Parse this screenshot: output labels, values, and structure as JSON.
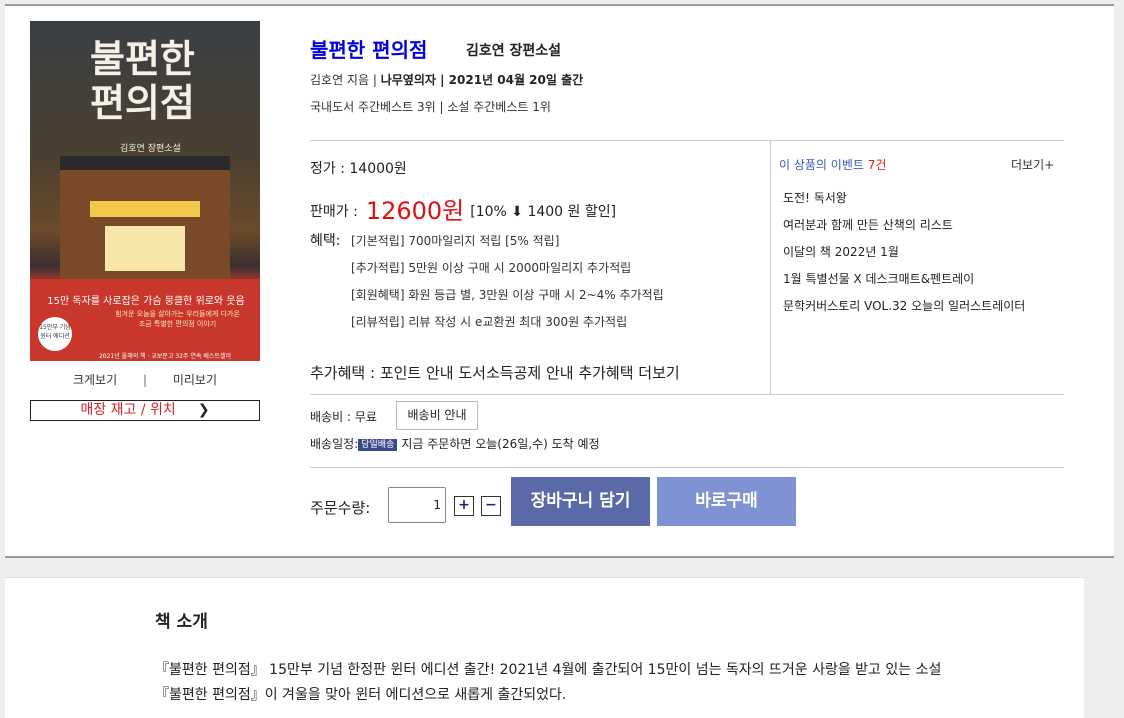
{
  "book": {
    "title": "불편한 편의점",
    "subtitle": "김호연 장편소설",
    "author": "김호연 지음 |",
    "publisher_date": "나무옆의자 | 2021년 04월 20일 출간",
    "ranking": "국내도서 주간베스트 3위 | 소설 주간베스트 1위"
  },
  "cover": {
    "title_line1": "불편한",
    "title_line2": "편의점",
    "author_small": "김호연 장편소설",
    "tagline": "15만 독자를 사로잡은 가슴 뭉클한 위로와 웃음",
    "sub_line1": "힘겨운 오늘을 살아가는 우리들에게 다가온",
    "sub_line2": "조금 특별한 편의점 이야기",
    "badge": "15만부 기념 윈터 에디션",
    "footer": "2021년 올해의 책 · 교보문고 32주 연속 베스트셀러"
  },
  "links": {
    "enlarge": "크게보기",
    "sep": "|",
    "preview": "미리보기",
    "stock": "매장 재고 / 위치"
  },
  "price": {
    "list": "정가 : 14000원",
    "sale_label": "판매가 :",
    "sale_amount": "12600원",
    "discount": "[10% ⬇ 1400 원 할인]",
    "benefit_label": "혜택:",
    "benefits": [
      "[기본적립] 700마일리지 적립 [5% 적립]",
      "[추가적립] 5만원 이상 구매 시 2000마일리지 추가적립",
      "[회원혜택] 화원 등급 별, 3만원 이상 구매 시 2~4% 추가적립",
      "[리뷰적립] 리뷰 작성 시 e교환권 최대 300원 추가적립"
    ],
    "extra_label": "추가혜택 :",
    "extra_items": [
      "포인트 안내",
      "도서소득공제 안내",
      "추가혜택 더보기"
    ]
  },
  "events": {
    "head": "이 상품의 이벤트",
    "count": "7건",
    "more": "더보기+",
    "items": [
      "도전! 독서왕",
      "여러분과 함께 만든 산책의 리스트",
      "이달의 책 2022년 1월",
      "1월 특별선물 X 데스크매트&펜트레이",
      "문학커버스토리 VOL.32 오늘의 일러스트레이터"
    ]
  },
  "shipping": {
    "fee": "배송비 : 무료",
    "fee_button": "배송비 안내",
    "schedule_label": "배송일정:",
    "schedule_tag": "당일배송",
    "schedule_text": "지금 주문하면 오늘(26일,수) 도착 예정"
  },
  "order": {
    "qty_label": "주문수량:",
    "qty_value": "1",
    "plus": "+",
    "minus": "−",
    "cart": "장바구니 담기",
    "buy": "바로구매"
  },
  "intro": {
    "title": "책 소개",
    "text": "『불편한 편의점』 15만부 기념 한정판 윈터 에디션 출간! 2021년 4월에 출간되어 15만이 넘는 독자의 뜨거운 사랑을 받고 있는 소설 『불편한 편의점』이 겨울을 맞아 윈터 에디션으로 새롭게 출간되었다."
  },
  "colors": {
    "title": "#0000dd",
    "sale": "#e01010",
    "cart": "#5a6aa8",
    "buy": "#7f93d4",
    "event_head": "#3a5bb8"
  }
}
